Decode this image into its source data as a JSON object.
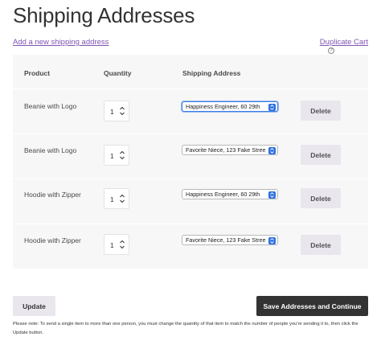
{
  "page": {
    "title": "Shipping Addresses",
    "add_link": "Add a new shipping address",
    "duplicate_link": "Duplicate Cart",
    "help_icon": "?"
  },
  "table": {
    "headers": {
      "product": "Product",
      "quantity": "Quantity",
      "address": "Shipping Address"
    },
    "rows": [
      {
        "product": "Beanie with Logo",
        "quantity": "1",
        "address": "Happiness Engineer, 60 29th",
        "delete": "Delete"
      },
      {
        "product": "Beanie with Logo",
        "quantity": "1",
        "address": "Favorite Niece, 123 Fake Stree",
        "delete": "Delete"
      },
      {
        "product": "Hoodie with Zipper",
        "quantity": "1",
        "address": "Happiness Engineer, 60 29th",
        "delete": "Delete"
      },
      {
        "product": "Hoodie with Zipper",
        "quantity": "1",
        "address": "Favorite Niece, 123 Fake Stree",
        "delete": "Delete"
      }
    ]
  },
  "actions": {
    "update": "Update",
    "save": "Save Addresses and Continue"
  },
  "note": "Please note: To send a single item to more than one person, you must change the quantity of that item to match the number of people you're sending it to, then click the Update button.",
  "colors": {
    "link": "#7f54b3",
    "primary_button": "#333333",
    "secondary_button": "#e9e6ed",
    "focus": "#3b7ce6"
  }
}
